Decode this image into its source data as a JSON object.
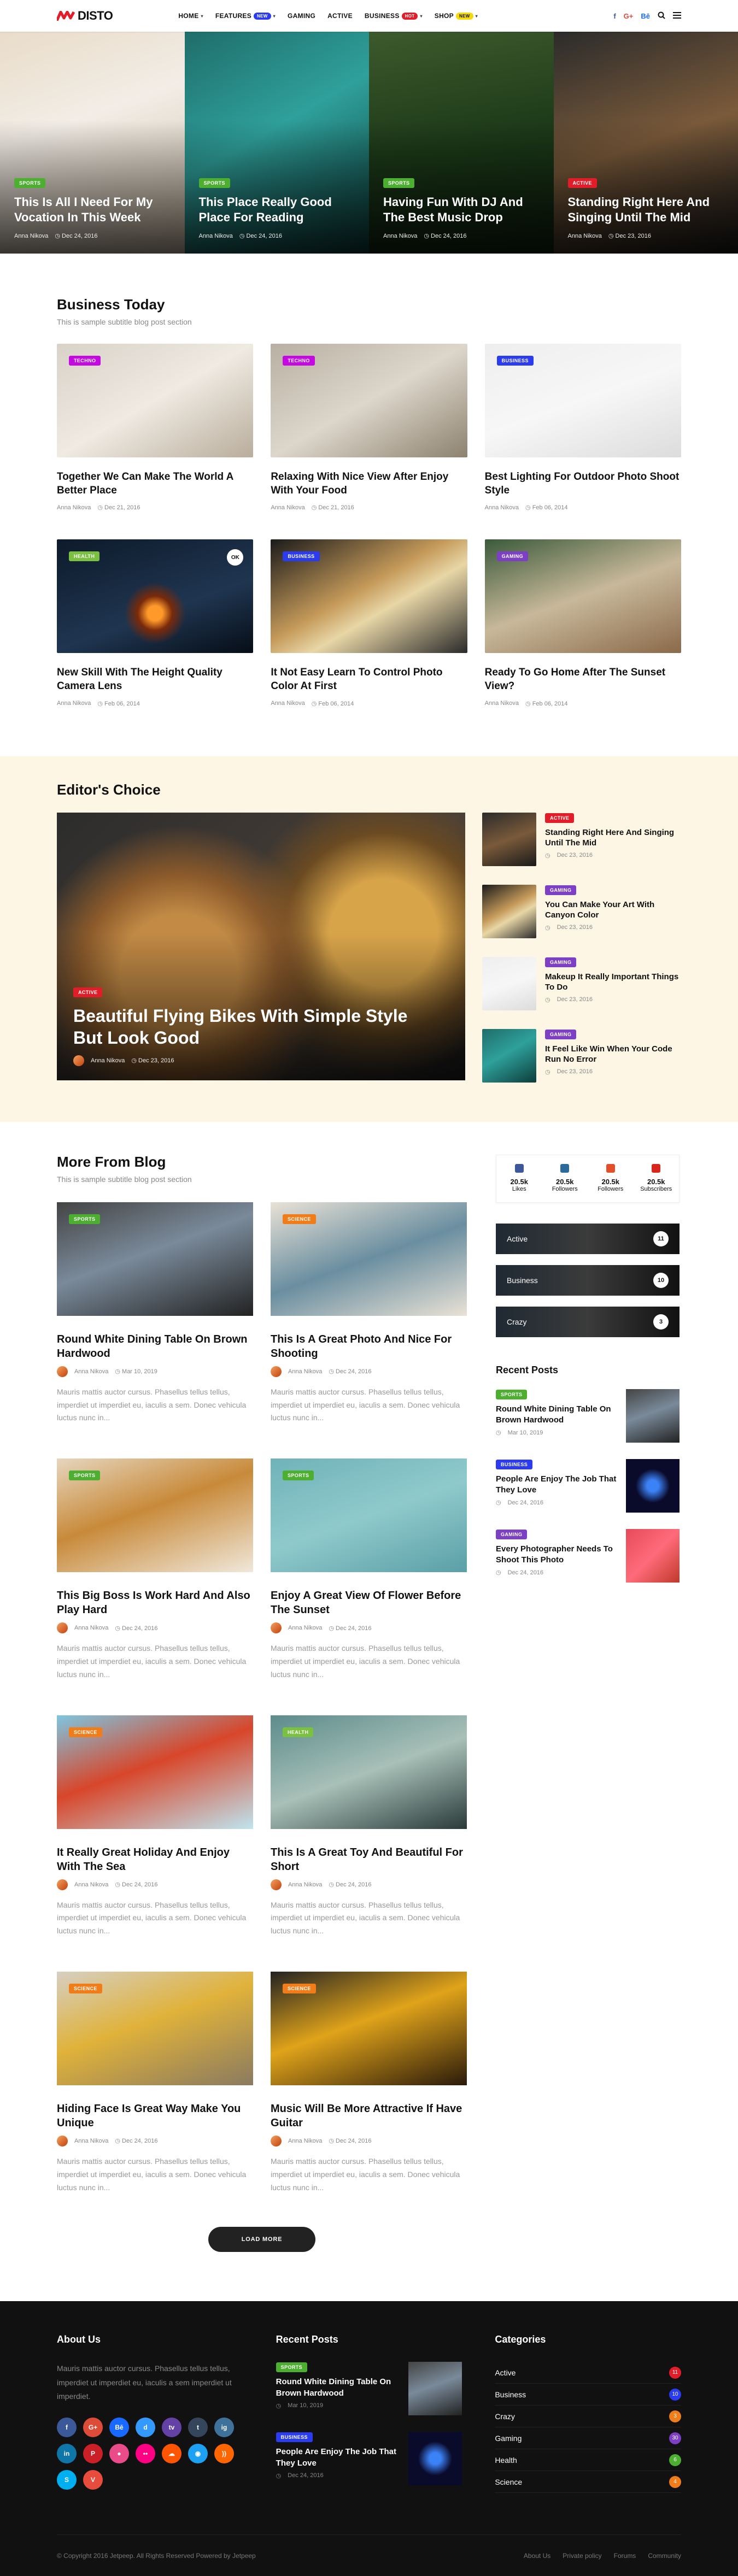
{
  "brand": {
    "name": "DISTO",
    "accent": "#e11d2a"
  },
  "nav": [
    {
      "label": "HOME",
      "caret": true
    },
    {
      "label": "FEATURES",
      "caret": true,
      "badge": "NEW",
      "badge_color": "#2b3bf0"
    },
    {
      "label": "GAMING"
    },
    {
      "label": "ACTIVE"
    },
    {
      "label": "BUSINESS",
      "caret": true,
      "badge": "HOT",
      "badge_color": "#e11d2a"
    },
    {
      "label": "SHOP",
      "caret": true,
      "badge": "NEW",
      "badge_color": "#f5d90a"
    }
  ],
  "header_icons": [
    "facebook-icon",
    "google-plus-icon",
    "behance-icon",
    "search-icon",
    "menu-icon"
  ],
  "hero": [
    {
      "cat": "SPORTS",
      "cat_color": "#4caf2f",
      "title": "This Is All I Need For My Vocation In This Week",
      "author": "Anna Nikova",
      "date": "Dec 24, 2016"
    },
    {
      "cat": "SPORTS",
      "cat_color": "#4caf2f",
      "title": "This Place Really Good Place For Reading",
      "author": "Anna Nikova",
      "date": "Dec 24, 2016"
    },
    {
      "cat": "SPORTS",
      "cat_color": "#4caf2f",
      "title": "Having Fun With DJ And The Best Music Drop",
      "author": "Anna Nikova",
      "date": "Dec 24, 2016"
    },
    {
      "cat": "ACTIVE",
      "cat_color": "#e11d2a",
      "title": "Standing Right Here And Singing Until The Mid",
      "author": "Anna Nikova",
      "date": "Dec 23, 2016"
    }
  ],
  "business": {
    "title": "Business Today",
    "subtitle": "This is sample subtitle blog post section",
    "posts": [
      {
        "cat": "TECHNO",
        "cat_color": "#c40ae0",
        "title": "Together We Can Make The World A Better Place",
        "author": "Anna Nikova",
        "date": "Dec 21, 2016"
      },
      {
        "cat": "TECHNO",
        "cat_color": "#c40ae0",
        "title": "Relaxing With Nice View After Enjoy With Your Food",
        "author": "Anna Nikova",
        "date": "Dec 21, 2016"
      },
      {
        "cat": "BUSINESS",
        "cat_color": "#2b3bf0",
        "title": "Best Lighting For Outdoor Photo Shoot Style",
        "author": "Anna Nikova",
        "date": "Feb 06, 2014"
      },
      {
        "cat": "HEALTH",
        "cat_color": "#7ac142",
        "title": "New Skill With The Height Quality Camera Lens",
        "author": "Anna Nikova",
        "date": "Feb 06, 2014",
        "extra_badge": "OK"
      },
      {
        "cat": "BUSINESS",
        "cat_color": "#2b3bf0",
        "title": "It Not Easy Learn To Control Photo Color At First",
        "author": "Anna Nikova",
        "date": "Feb 06, 2014"
      },
      {
        "cat": "GAMING",
        "cat_color": "#7d3fc4",
        "title": "Ready To Go Home After The Sunset View?",
        "author": "Anna Nikova",
        "date": "Feb 06, 2014"
      }
    ]
  },
  "editors": {
    "title": "Editor's Choice",
    "main": {
      "cat": "ACTIVE",
      "cat_color": "#e11d2a",
      "title": "Beautiful Flying Bikes With Simple Style But Look Good",
      "author": "Anna Nikova",
      "date": "Dec 23, 2016"
    },
    "list": [
      {
        "cat": "ACTIVE",
        "cat_color": "#e11d2a",
        "title": "Standing Right Here And Singing Until The Mid",
        "date": "Dec 23, 2016"
      },
      {
        "cat": "GAMING",
        "cat_color": "#7d3fc4",
        "title": "You Can Make Your Art With Canyon Color",
        "date": "Dec 23, 2016"
      },
      {
        "cat": "GAMING",
        "cat_color": "#7d3fc4",
        "title": "Makeup It Really Important Things To Do",
        "date": "Dec 23, 2016"
      },
      {
        "cat": "GAMING",
        "cat_color": "#7d3fc4",
        "title": "It Feel Like Win When Your Code Run No Error",
        "date": "Dec 23, 2016"
      }
    ]
  },
  "more": {
    "title": "More From Blog",
    "subtitle": "This is sample subtitle blog post section",
    "excerpt": "Mauris mattis auctor cursus. Phasellus tellus tellus, imperdiet ut imperdiet eu, iaculis a sem. Donec vehicula luctus nunc in...",
    "posts": [
      {
        "cat": "SPORTS",
        "cat_color": "#4caf2f",
        "title": "Round White Dining Table On Brown Hardwood",
        "author": "Anna Nikova",
        "date": "Mar 10, 2019"
      },
      {
        "cat": "SCIENCE",
        "cat_color": "#f07d1a",
        "title": "This Is A Great Photo And Nice For Shooting",
        "author": "Anna Nikova",
        "date": "Dec 24, 2016"
      },
      {
        "cat": "SPORTS",
        "cat_color": "#4caf2f",
        "title": "This Big Boss Is Work Hard And Also Play Hard",
        "author": "Anna Nikova",
        "date": "Dec 24, 2016"
      },
      {
        "cat": "SPORTS",
        "cat_color": "#4caf2f",
        "title": "Enjoy A Great View Of Flower Before The Sunset",
        "author": "Anna Nikova",
        "date": "Dec 24, 2016"
      },
      {
        "cat": "SCIENCE",
        "cat_color": "#f07d1a",
        "title": "It Really Great Holiday And Enjoy With The Sea",
        "author": "Anna Nikova",
        "date": "Dec 24, 2016"
      },
      {
        "cat": "HEALTH",
        "cat_color": "#7ac142",
        "title": "This Is A Great Toy And Beautiful For Short",
        "author": "Anna Nikova",
        "date": "Dec 24, 2016"
      },
      {
        "cat": "SCIENCE",
        "cat_color": "#f07d1a",
        "title": "Hiding Face Is Great Way Make You Unique",
        "author": "Anna Nikova",
        "date": "Dec 24, 2016"
      },
      {
        "cat": "SCIENCE",
        "cat_color": "#f07d1a",
        "title": "Music Will Be More Attractive If Have Guitar",
        "author": "Anna Nikova",
        "date": "Dec 24, 2016"
      }
    ],
    "load_more": "LOAD MORE"
  },
  "sidebar": {
    "social": [
      {
        "icon": "facebook-icon",
        "count": "20.5k",
        "label": "Likes",
        "color": "#3b5998"
      },
      {
        "icon": "instagram-icon",
        "count": "20.5k",
        "label": "Followers",
        "color": "#2a6b9c"
      },
      {
        "icon": "pinterest-icon",
        "count": "20.5k",
        "label": "Followers",
        "color": "#e1502a"
      },
      {
        "icon": "youtube-icon",
        "count": "20.5k",
        "label": "Subscribers",
        "color": "#d9261c"
      }
    ],
    "categories": [
      {
        "name": "Active",
        "count": "11"
      },
      {
        "name": "Business",
        "count": "10"
      },
      {
        "name": "Crazy",
        "count": "3"
      }
    ],
    "recent_title": "Recent Posts",
    "recent": [
      {
        "cat": "SPORTS",
        "cat_color": "#4caf2f",
        "title": "Round White Dining Table On Brown Hardwood",
        "date": "Mar 10, 2019"
      },
      {
        "cat": "BUSINESS",
        "cat_color": "#2b3bf0",
        "title": "People Are Enjoy The Job That They Love",
        "date": "Dec 24, 2016"
      },
      {
        "cat": "GAMING",
        "cat_color": "#7d3fc4",
        "title": "Every Photographer Needs To Shoot This Photo",
        "date": "Dec 24, 2016"
      }
    ]
  },
  "footer": {
    "about_title": "About Us",
    "about_text": "Mauris mattis auctor cursus. Phasellus tellus tellus, imperdiet ut imperdiet eu, iaculis a sem imperdiet ut imperdiet.",
    "social_icons": [
      {
        "icon": "facebook-icon",
        "glyph": "f",
        "color": "#3b5998"
      },
      {
        "icon": "google-plus-icon",
        "glyph": "G+",
        "color": "#dd4b39"
      },
      {
        "icon": "behance-icon",
        "glyph": "Bē",
        "color": "#1769ff"
      },
      {
        "icon": "delicious-icon",
        "glyph": "d",
        "color": "#3399ff"
      },
      {
        "icon": "twitch-icon",
        "glyph": "tv",
        "color": "#6441a5"
      },
      {
        "icon": "tumblr-icon",
        "glyph": "t",
        "color": "#35465c"
      },
      {
        "icon": "instagram-icon",
        "glyph": "ig",
        "color": "#3f729b"
      },
      {
        "icon": "linkedin-icon",
        "glyph": "in",
        "color": "#0e76a8"
      },
      {
        "icon": "pinterest-icon",
        "glyph": "P",
        "color": "#cb2027"
      },
      {
        "icon": "dribbble-icon",
        "glyph": "●",
        "color": "#ea4c89"
      },
      {
        "icon": "flickr-icon",
        "glyph": "••",
        "color": "#ff0084"
      },
      {
        "icon": "soundcloud-icon",
        "glyph": "☁",
        "color": "#ff5500"
      },
      {
        "icon": "snapchat-icon",
        "glyph": "◉",
        "color": "#1da1f2"
      },
      {
        "icon": "rss-icon",
        "glyph": "))",
        "color": "#ff6600"
      },
      {
        "icon": "skype-icon",
        "glyph": "S",
        "color": "#00aff0"
      },
      {
        "icon": "vine-icon",
        "glyph": "V",
        "color": "#e74c3c"
      }
    ],
    "recent_title": "Recent Posts",
    "recent": [
      {
        "cat": "SPORTS",
        "cat_color": "#4caf2f",
        "title": "Round White Dining Table On Brown Hardwood",
        "date": "Mar 10, 2019"
      },
      {
        "cat": "BUSINESS",
        "cat_color": "#2b3bf0",
        "title": "People Are Enjoy The Job That They Love",
        "date": "Dec 24, 2016"
      }
    ],
    "categories_title": "Categories",
    "categories": [
      {
        "name": "Active",
        "count": "11",
        "color": "#e11d2a"
      },
      {
        "name": "Business",
        "count": "10",
        "color": "#2b3bf0"
      },
      {
        "name": "Crazy",
        "count": "3",
        "color": "#f07d1a"
      },
      {
        "name": "Gaming",
        "count": "30",
        "color": "#7d3fc4"
      },
      {
        "name": "Health",
        "count": "6",
        "color": "#4caf2f"
      },
      {
        "name": "Science",
        "count": "4",
        "color": "#f07d1a"
      }
    ],
    "copyright": "© Copyright 2016 Jetpeep. All Rights Reserved Powered by Jetpeep",
    "links": [
      "About Us",
      "Private policy",
      "Forums",
      "Community"
    ]
  }
}
